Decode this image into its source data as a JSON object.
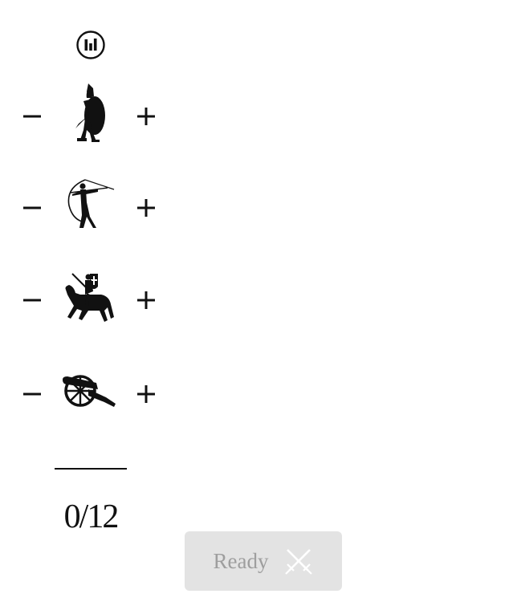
{
  "stats_button": {
    "icon": "bar-chart-icon"
  },
  "units": [
    {
      "name": "infantry",
      "icon": "hoplite-soldier-icon",
      "minus": "−",
      "plus": "+"
    },
    {
      "name": "archer",
      "icon": "archer-icon",
      "minus": "−",
      "plus": "+"
    },
    {
      "name": "cavalry",
      "icon": "knight-on-horse-icon",
      "minus": "−",
      "plus": "+"
    },
    {
      "name": "artillery",
      "icon": "cannon-icon",
      "minus": "−",
      "plus": "+"
    }
  ],
  "army_count": {
    "current": 0,
    "max": 12,
    "text": "0/12"
  },
  "ready_button": {
    "label": "Ready",
    "icon": "crossed-swords-icon",
    "enabled": false
  },
  "colors": {
    "ink": "#111111",
    "button_bg_disabled": "#e3e3e3",
    "button_text_disabled": "#9e9e9e"
  }
}
